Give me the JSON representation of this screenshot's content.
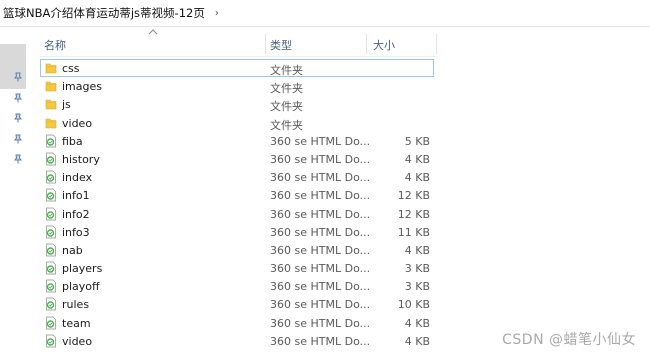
{
  "breadcrumb": {
    "path": "篮球NBA介绍体育运动蒂js蒂视频-12页",
    "separator": "›"
  },
  "columns": {
    "name": "名称",
    "type": "类型",
    "size": "大小"
  },
  "files": [
    {
      "name": "css",
      "type": "文件夹",
      "size": "",
      "icon": "folder-icon"
    },
    {
      "name": "images",
      "type": "文件夹",
      "size": "",
      "icon": "folder-icon"
    },
    {
      "name": "js",
      "type": "文件夹",
      "size": "",
      "icon": "folder-icon"
    },
    {
      "name": "video",
      "type": "文件夹",
      "size": "",
      "icon": "folder-icon"
    },
    {
      "name": "fiba",
      "type": "360 se HTML Do...",
      "size": "5 KB",
      "icon": "html-file-icon"
    },
    {
      "name": "history",
      "type": "360 se HTML Do...",
      "size": "4 KB",
      "icon": "html-file-icon"
    },
    {
      "name": "index",
      "type": "360 se HTML Do...",
      "size": "4 KB",
      "icon": "html-file-icon"
    },
    {
      "name": "info1",
      "type": "360 se HTML Do...",
      "size": "12 KB",
      "icon": "html-file-icon"
    },
    {
      "name": "info2",
      "type": "360 se HTML Do...",
      "size": "12 KB",
      "icon": "html-file-icon"
    },
    {
      "name": "info3",
      "type": "360 se HTML Do...",
      "size": "11 KB",
      "icon": "html-file-icon"
    },
    {
      "name": "nab",
      "type": "360 se HTML Do...",
      "size": "4 KB",
      "icon": "html-file-icon"
    },
    {
      "name": "players",
      "type": "360 se HTML Do...",
      "size": "3 KB",
      "icon": "html-file-icon"
    },
    {
      "name": "playoff",
      "type": "360 se HTML Do...",
      "size": "3 KB",
      "icon": "html-file-icon"
    },
    {
      "name": "rules",
      "type": "360 se HTML Do...",
      "size": "10 KB",
      "icon": "html-file-icon"
    },
    {
      "name": "team",
      "type": "360 se HTML Do...",
      "size": "4 KB",
      "icon": "html-file-icon"
    },
    {
      "name": "video",
      "type": "360 se HTML Do...",
      "size": "4 KB",
      "icon": "html-file-icon"
    }
  ],
  "watermark": "CSDN @蜡笔小仙女",
  "colors": {
    "folder": "#f5c842",
    "selection_border": "#99c9ef",
    "header_text": "#4c607a",
    "html_icon_green": "#4caf50"
  }
}
